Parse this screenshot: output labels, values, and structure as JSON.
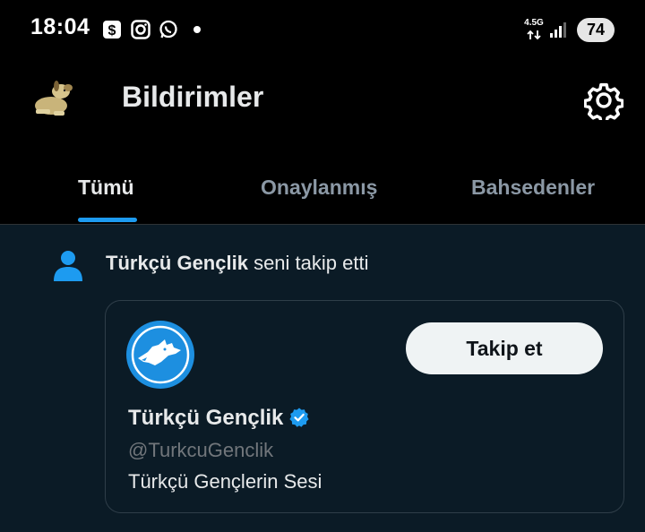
{
  "status_bar": {
    "time": "18:04",
    "icons": [
      "dollar-app-icon",
      "instagram-icon",
      "whatsapp-icon"
    ],
    "network_type": "4.5G",
    "battery": "74"
  },
  "header": {
    "title": "Bildirimler",
    "avatar_icon": "dog-avatar",
    "settings_icon": "gear-icon"
  },
  "tabs": [
    {
      "label": "Tümü",
      "active": true
    },
    {
      "label": "Onaylanmış",
      "active": false
    },
    {
      "label": "Bahsedenler",
      "active": false
    }
  ],
  "notification": {
    "icon": "person-icon",
    "actor": "Türkçü Gençlik",
    "action": " seni takip etti",
    "card": {
      "name": "Türkçü Gençlik",
      "handle": "@TurkcuGenclik",
      "bio": "Türkçü Gençlerin Sesi",
      "follow_label": "Takip et",
      "verified": true
    }
  },
  "colors": {
    "accent": "#1d9bf0",
    "feed_bg": "#0b1b26",
    "card_border": "#2f3e49"
  }
}
